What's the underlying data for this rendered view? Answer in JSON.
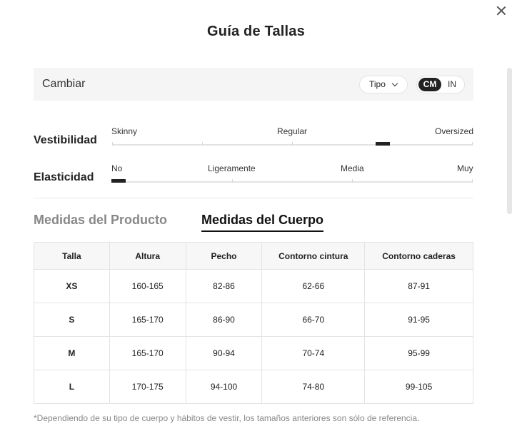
{
  "modal": {
    "title": "Guía de Tallas",
    "close_icon": "close-icon"
  },
  "unit_bar": {
    "change_label": "Cambiar",
    "type_select_label": "Tipo",
    "unit_options": [
      "CM",
      "IN"
    ],
    "selected_unit": "CM"
  },
  "fit_scale": {
    "label": "Vestibilidad",
    "ticks": [
      "Skinny",
      "Regular",
      "Oversized"
    ],
    "marker_position_fraction": 0.75
  },
  "elasticity_scale": {
    "label": "Elasticidad",
    "ticks": [
      "No",
      "Ligeramente",
      "Media",
      "Muy"
    ],
    "marker_position_fraction": 0.0
  },
  "tabs": [
    {
      "label": "Medidas del Producto",
      "active": false
    },
    {
      "label": "Medidas del Cuerpo",
      "active": true
    }
  ],
  "table": {
    "headers": [
      "Talla",
      "Altura",
      "Pecho",
      "Contorno cintura",
      "Contorno caderas"
    ],
    "rows": [
      [
        "XS",
        "160-165",
        "82-86",
        "62-66",
        "87-91"
      ],
      [
        "S",
        "165-170",
        "86-90",
        "66-70",
        "91-95"
      ],
      [
        "M",
        "165-170",
        "90-94",
        "70-74",
        "95-99"
      ],
      [
        "L",
        "170-175",
        "94-100",
        "74-80",
        "99-105"
      ]
    ]
  },
  "footnote": "*Dependiendo de su tipo de cuerpo y hábitos de vestir, los tamaños anteriores son sólo de referencia."
}
